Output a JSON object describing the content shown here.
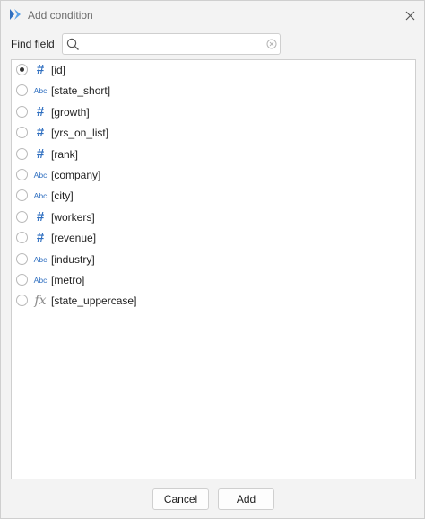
{
  "window": {
    "title": "Add condition",
    "app_icon": "app-logo-icon",
    "close_icon": "close-icon"
  },
  "search": {
    "label": "Find field",
    "value": "",
    "placeholder": ""
  },
  "fields": [
    {
      "type": "number",
      "icon": "#",
      "label": "[id]",
      "selected": true
    },
    {
      "type": "text",
      "icon": "Abc",
      "label": "[state_short]",
      "selected": false
    },
    {
      "type": "number",
      "icon": "#",
      "label": "[growth]",
      "selected": false
    },
    {
      "type": "number",
      "icon": "#",
      "label": "[yrs_on_list]",
      "selected": false
    },
    {
      "type": "number",
      "icon": "#",
      "label": "[rank]",
      "selected": false
    },
    {
      "type": "text",
      "icon": "Abc",
      "label": "[company]",
      "selected": false
    },
    {
      "type": "text",
      "icon": "Abc",
      "label": "[city]",
      "selected": false
    },
    {
      "type": "number",
      "icon": "#",
      "label": "[workers]",
      "selected": false
    },
    {
      "type": "number",
      "icon": "#",
      "label": "[revenue]",
      "selected": false
    },
    {
      "type": "text",
      "icon": "Abc",
      "label": "[industry]",
      "selected": false
    },
    {
      "type": "text",
      "icon": "Abc",
      "label": "[metro]",
      "selected": false
    },
    {
      "type": "formula",
      "icon": "fx",
      "label": "[state_uppercase]",
      "selected": false
    }
  ],
  "buttons": {
    "cancel": "Cancel",
    "add": "Add"
  },
  "colors": {
    "accent": "#2f6fc0",
    "background": "#f3f3f3"
  }
}
